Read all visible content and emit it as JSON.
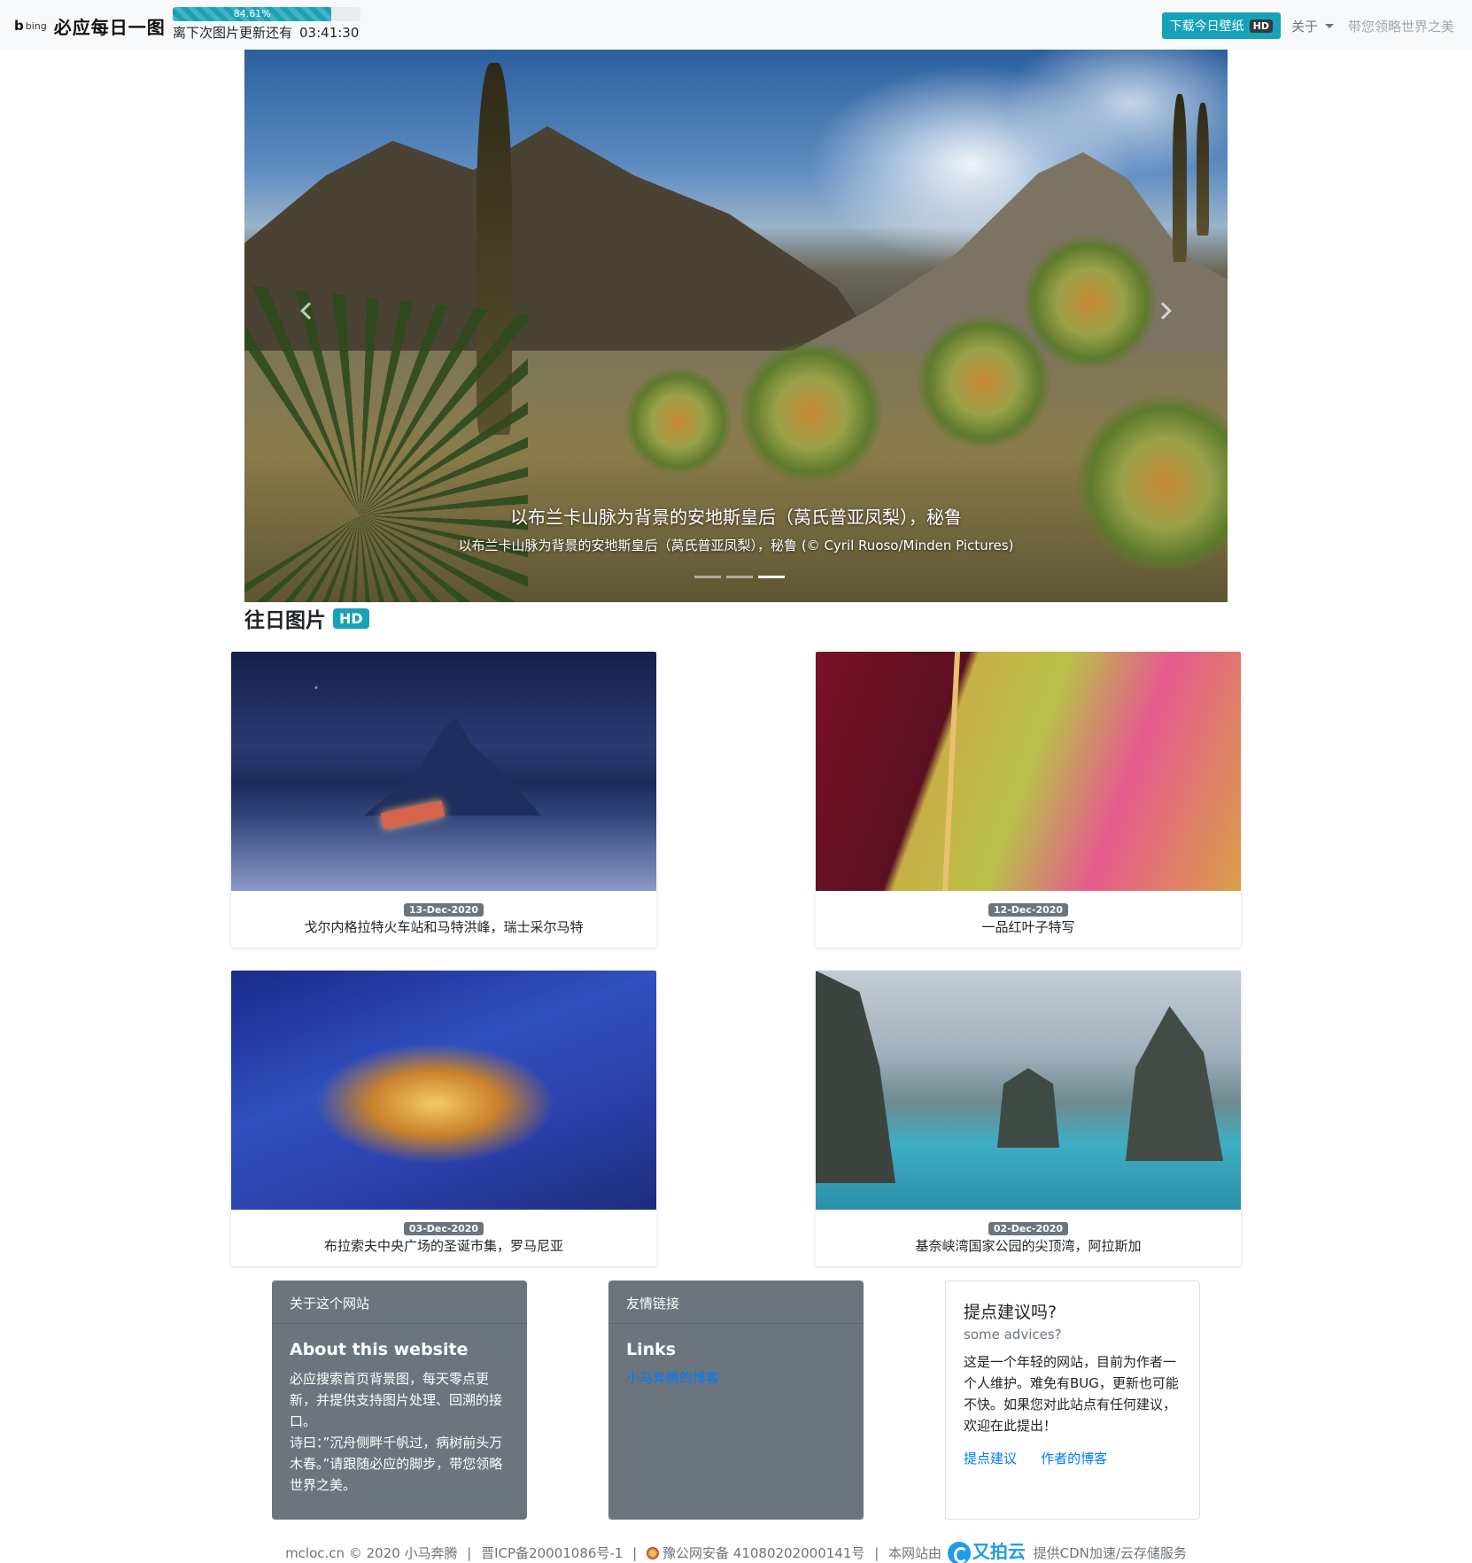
{
  "navbar": {
    "bing_text": "bing",
    "brand": "必应每日一图",
    "progress": {
      "label": "84.61%",
      "fraction": 0.8461
    },
    "countdown_label": "离下次图片更新还有",
    "countdown_time": "03:41:30",
    "download_label": "下载今日壁纸",
    "hd": "HD",
    "about_label": "关于",
    "slogan": "带您领略世界之美"
  },
  "hero": {
    "title": "以布兰卡山脉为背景的安地斯皇后（莴氏普亚凤梨），秘鲁",
    "subtitle": "以布兰卡山脉为背景的安地斯皇后（莴氏普亚凤梨），秘鲁 (© Cyril Ruoso/Minden Pictures)",
    "indicator_count": 3,
    "active_indicator": 2
  },
  "past": {
    "heading": "往日图片",
    "badge": "HD",
    "cards": [
      {
        "date": "13-Dec-2020",
        "title": "戈尔内格拉特火车站和马特洪峰，瑞士采尔马特"
      },
      {
        "date": "12-Dec-2020",
        "title": "一品红叶子特写"
      },
      {
        "date": "03-Dec-2020",
        "title": "布拉索夫中央广场的圣诞市集，罗马尼亚"
      },
      {
        "date": "02-Dec-2020",
        "title": "基奈峡湾国家公园的尖顶湾，阿拉斯加"
      }
    ]
  },
  "footer_cards": {
    "about": {
      "header": "关于这个网站",
      "title": "About this website",
      "text1": "必应搜索首页背景图，每天零点更新，并提供支持图片处理、回溯的接口。",
      "text2": "诗曰：”沉舟侧畔千帆过，病树前头万木春。”请跟随必应的脚步，带您领略世界之美。"
    },
    "links": {
      "header": "友情链接",
      "title": "Links",
      "link": "小马奔腾的博客"
    },
    "advice": {
      "title": "提点建议吗?",
      "subtitle": "some advices?",
      "text": "这是一个年轻的网站，目前为作者一个人维护。难免有BUG，更新也可能不快。如果您对此站点有任何建议，欢迎在此提出！",
      "link1": "提点建议",
      "link2": "作者的博客"
    }
  },
  "bottom": {
    "copyright": "mcloc.cn © 2020 小马奔腾",
    "icp": "晋ICP备20001086号-1",
    "police": "豫公网安备 41080202000141号",
    "cdn_prefix": "本网站由",
    "cdn_brand": "又拍云",
    "cdn_suffix": "提供CDN加速/云存储服务",
    "sep": "|"
  },
  "colors": {
    "accent": "#17a2b8",
    "card_dark": "#6c757d",
    "link": "#007bff"
  }
}
